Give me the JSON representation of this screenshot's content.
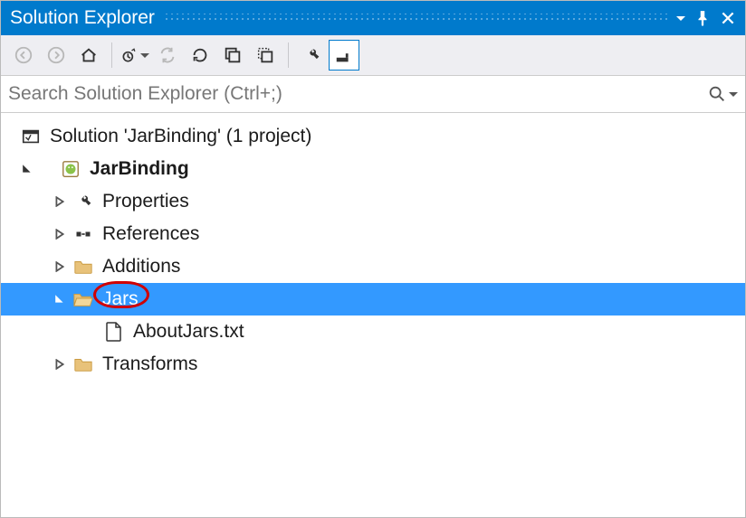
{
  "titlebar": {
    "title": "Solution Explorer"
  },
  "search": {
    "placeholder": "Search Solution Explorer (Ctrl+;)"
  },
  "tree": {
    "solution_label": "Solution 'JarBinding' (1 project)",
    "project_label": "JarBinding",
    "properties_label": "Properties",
    "references_label": "References",
    "additions_label": "Additions",
    "jars_label": "Jars",
    "aboutjars_label": "AboutJars.txt",
    "transforms_label": "Transforms"
  }
}
